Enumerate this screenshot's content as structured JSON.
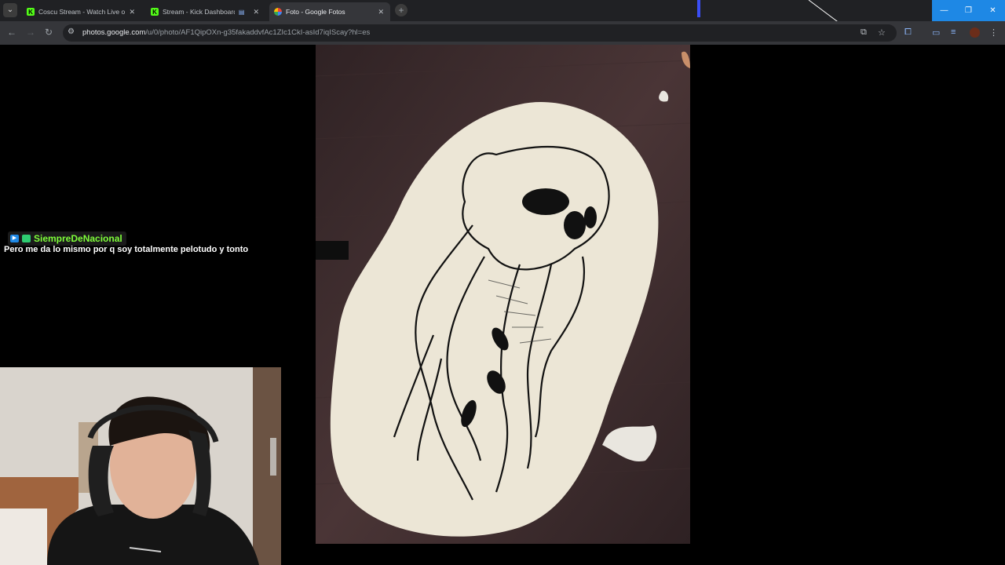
{
  "browser": {
    "tabs": [
      {
        "title": "Coscu Stream - Watch Live on K",
        "favicon": "kick-icon",
        "active": false
      },
      {
        "title": "Stream - Kick Dashboard",
        "favicon": "kick-icon",
        "active": false
      },
      {
        "title": "Foto - Google Fotos",
        "favicon": "google-photos-icon",
        "active": true
      }
    ],
    "url_host": "photos.google.com",
    "url_path": "/u/0/photo/AF1QipOXn-g35fakaddvfAc1ZIc1CkI-asId7iqIScay?hl=es"
  },
  "chat": {
    "username": "SiempreDeNacional",
    "message": "Pero me da lo mismo por q soy totalmente pelotudo y tonto",
    "username_color": "#7fff3a"
  },
  "colors": {
    "kick_green": "#53fc18",
    "window_controls": "#1e88e5",
    "paper": "#ece6d6"
  }
}
